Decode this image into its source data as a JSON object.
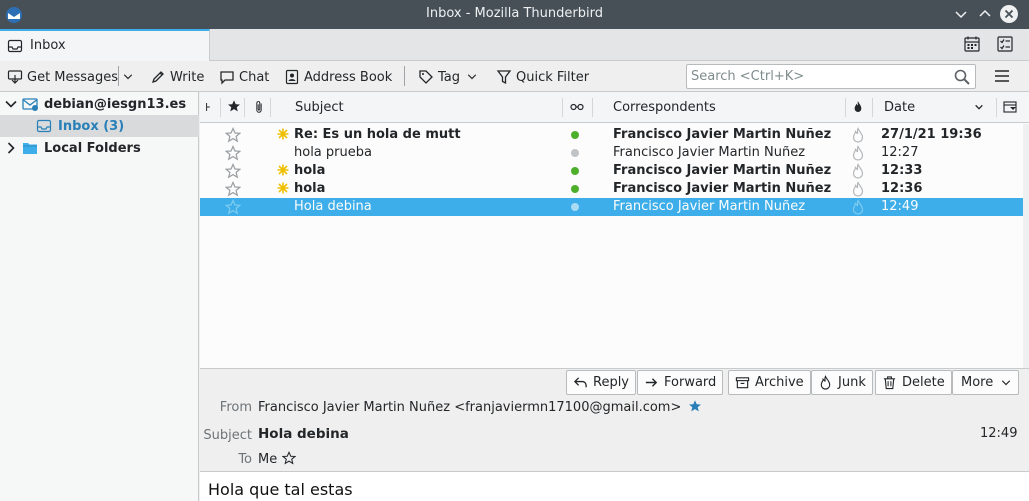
{
  "window": {
    "title": "Inbox - Mozilla Thunderbird"
  },
  "tab": {
    "label": "Inbox"
  },
  "toolbar": {
    "get_messages": "Get Messages",
    "write": "Write",
    "chat": "Chat",
    "address_book": "Address Book",
    "tag": "Tag",
    "quick_filter": "Quick Filter",
    "search_placeholder": "Search <Ctrl+K>"
  },
  "folders": [
    {
      "label": "debian@iesgn13.es",
      "bold": true
    },
    {
      "label": "Inbox (3)",
      "bold": true,
      "selected": true
    },
    {
      "label": "Local Folders",
      "bold": true
    }
  ],
  "columns": {
    "subject": "Subject",
    "correspondents": "Correspondents",
    "date": "Date"
  },
  "messages": [
    {
      "subject": "Re: Es un hola de mutt",
      "correspondent": "Francisco Javier Martin Nuñez",
      "date": "27/1/21 19:36",
      "unread": true,
      "selected": false,
      "dot": "#4db02a"
    },
    {
      "subject": "hola prueba",
      "correspondent": "Francisco Javier Martin Nuñez",
      "date": "12:27",
      "unread": false,
      "selected": false,
      "dot": "#c0c3c6"
    },
    {
      "subject": "hola",
      "correspondent": "Francisco Javier Martin Nuñez",
      "date": "12:33",
      "unread": true,
      "selected": false,
      "dot": "#4db02a"
    },
    {
      "subject": "hola",
      "correspondent": "Francisco Javier Martin Nuñez",
      "date": "12:36",
      "unread": true,
      "selected": false,
      "dot": "#4db02a"
    },
    {
      "subject": "Hola debina",
      "correspondent": "Francisco Javier Martin Nuñez",
      "date": "12:49",
      "unread": false,
      "selected": true,
      "dot": "#a9dcf4"
    }
  ],
  "header_buttons": {
    "reply": "Reply",
    "forward": "Forward",
    "archive": "Archive",
    "junk": "Junk",
    "delete": "Delete",
    "more": "More"
  },
  "message": {
    "from_label": "From",
    "from": "Francisco Javier Martin Nuñez <franjaviermn17100@gmail.com>",
    "subject_label": "Subject",
    "subject": "Hola debina",
    "time": "12:49",
    "to_label": "To",
    "to": "Me",
    "body": "Hola que tal estas"
  },
  "colors": {
    "accent": "#3daee9",
    "titlebar": "#475057",
    "read_dot": "#4db02a",
    "new_star": "#f0c000"
  }
}
